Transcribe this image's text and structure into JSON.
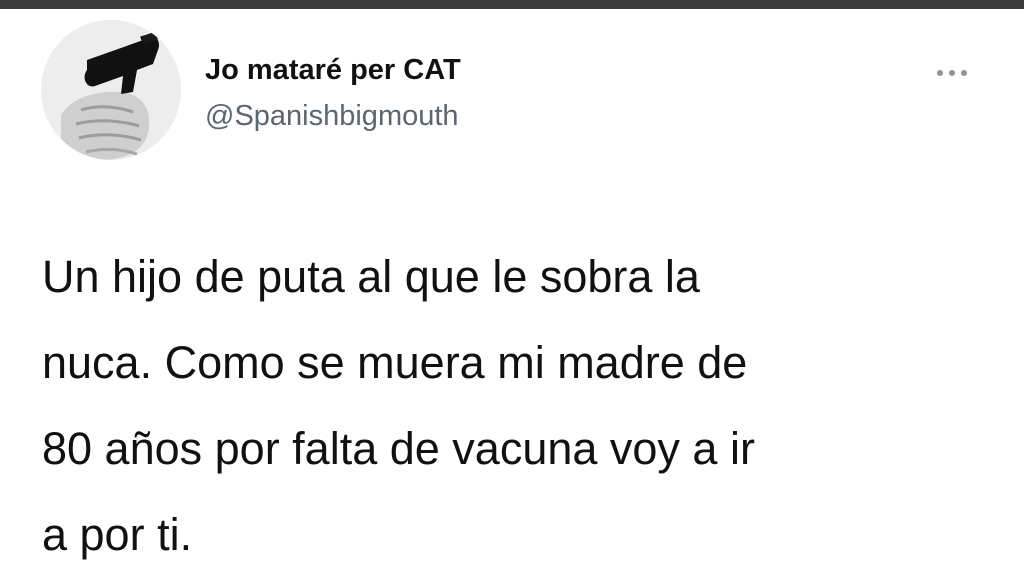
{
  "tweet": {
    "author": {
      "display_name": "Jo mataré per CAT",
      "handle": "@Spanishbigmouth"
    },
    "more_icon": "more-horizontal-icon",
    "text_lines": [
      "Un hijo de puta al que le sobra la",
      "nuca. Como se muera mi madre de",
      "80 años por falta de vacuna voy a ir",
      "a por ti."
    ]
  },
  "colors": {
    "top_bar": "#3a3a3a",
    "name": "#111111",
    "handle": "#5b6770",
    "text": "#111111",
    "more_dots": "#8a949c"
  }
}
